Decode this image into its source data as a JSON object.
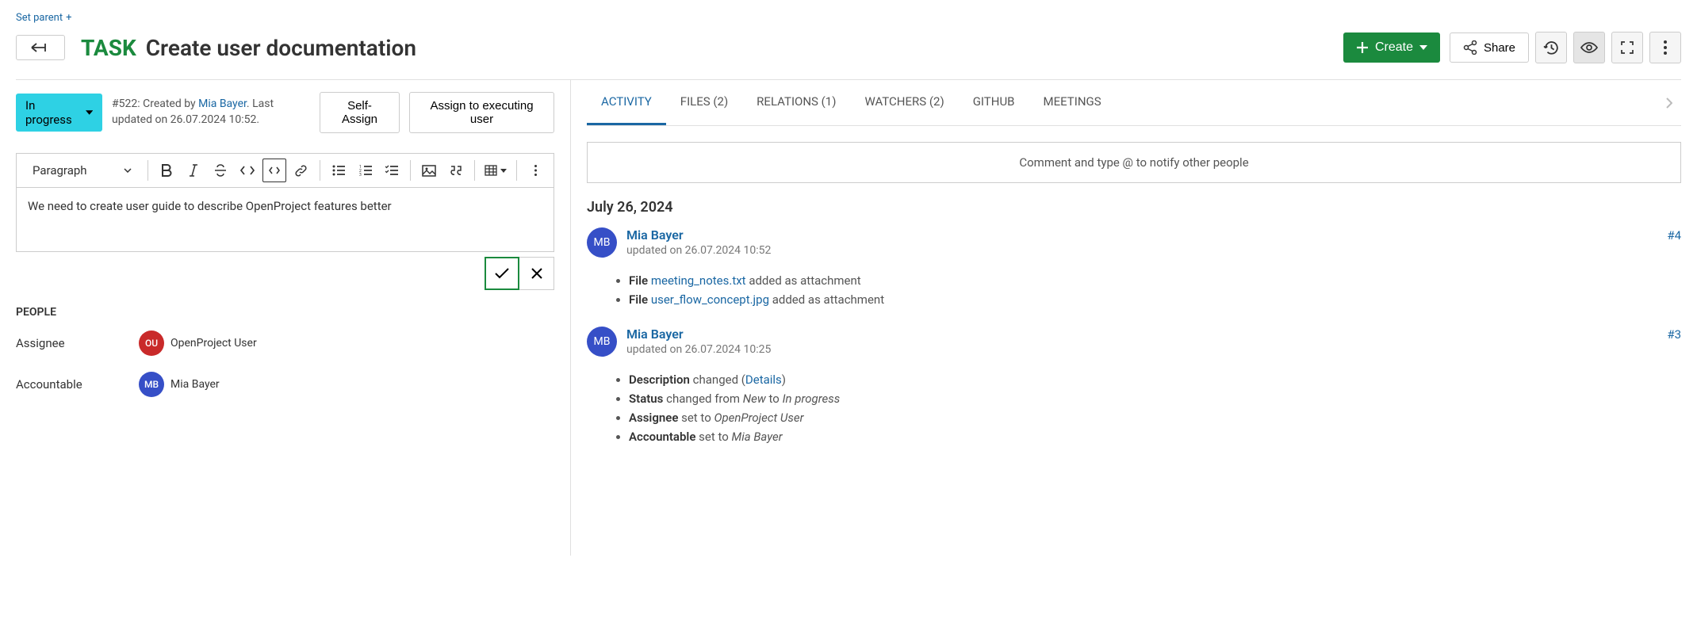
{
  "header": {
    "set_parent": "Set parent",
    "type_label": "TASK",
    "title": "Create user documentation",
    "create_label": "Create",
    "share_label": "Share"
  },
  "status": {
    "label": "In progress",
    "meta_prefix": "#522: Created by ",
    "meta_user": "Mia Bayer",
    "meta_suffix": ". Last updated on 26.07.2024 10:52.",
    "self_assign": "Self-Assign",
    "assign_executing": "Assign to executing user"
  },
  "editor": {
    "style_label": "Paragraph",
    "content": "We need to create user guide to describe OpenProject features better"
  },
  "people": {
    "section": "PEOPLE",
    "assignee_label": "Assignee",
    "assignee_initials": "OU",
    "assignee_name": "OpenProject User",
    "accountable_label": "Accountable",
    "accountable_initials": "MB",
    "accountable_name": "Mia Bayer"
  },
  "tabs": {
    "activity": "ACTIVITY",
    "files": "FILES (2)",
    "relations": "RELATIONS (1)",
    "watchers": "WATCHERS (2)",
    "github": "GITHUB",
    "meetings": "MEETINGS"
  },
  "comment_placeholder": "Comment and type @ to notify other people",
  "activity": {
    "date": "July 26, 2024",
    "items": [
      {
        "initials": "MB",
        "user": "Mia Bayer",
        "time": "updated on 26.07.2024 10:52",
        "num": "#4",
        "details": [
          {
            "bold": "File ",
            "link": "meeting_notes.txt",
            "suffix": " added as attachment"
          },
          {
            "bold": "File ",
            "link": "user_flow_concept.jpg",
            "suffix": " added as attachment"
          }
        ]
      },
      {
        "initials": "MB",
        "user": "Mia Bayer",
        "time": "updated on 26.07.2024 10:25",
        "num": "#3",
        "details": [
          {
            "bold": "Description",
            "text": " changed (",
            "link": "Details",
            "suffix": ")"
          },
          {
            "bold": "Status",
            "text": " changed from ",
            "italic1": "New",
            "mid": " to ",
            "italic2": "In progress"
          },
          {
            "bold": "Assignee",
            "text": " set to ",
            "italic1": "OpenProject User"
          },
          {
            "bold": "Accountable",
            "text": " set to ",
            "italic1": "Mia Bayer"
          }
        ]
      }
    ]
  }
}
